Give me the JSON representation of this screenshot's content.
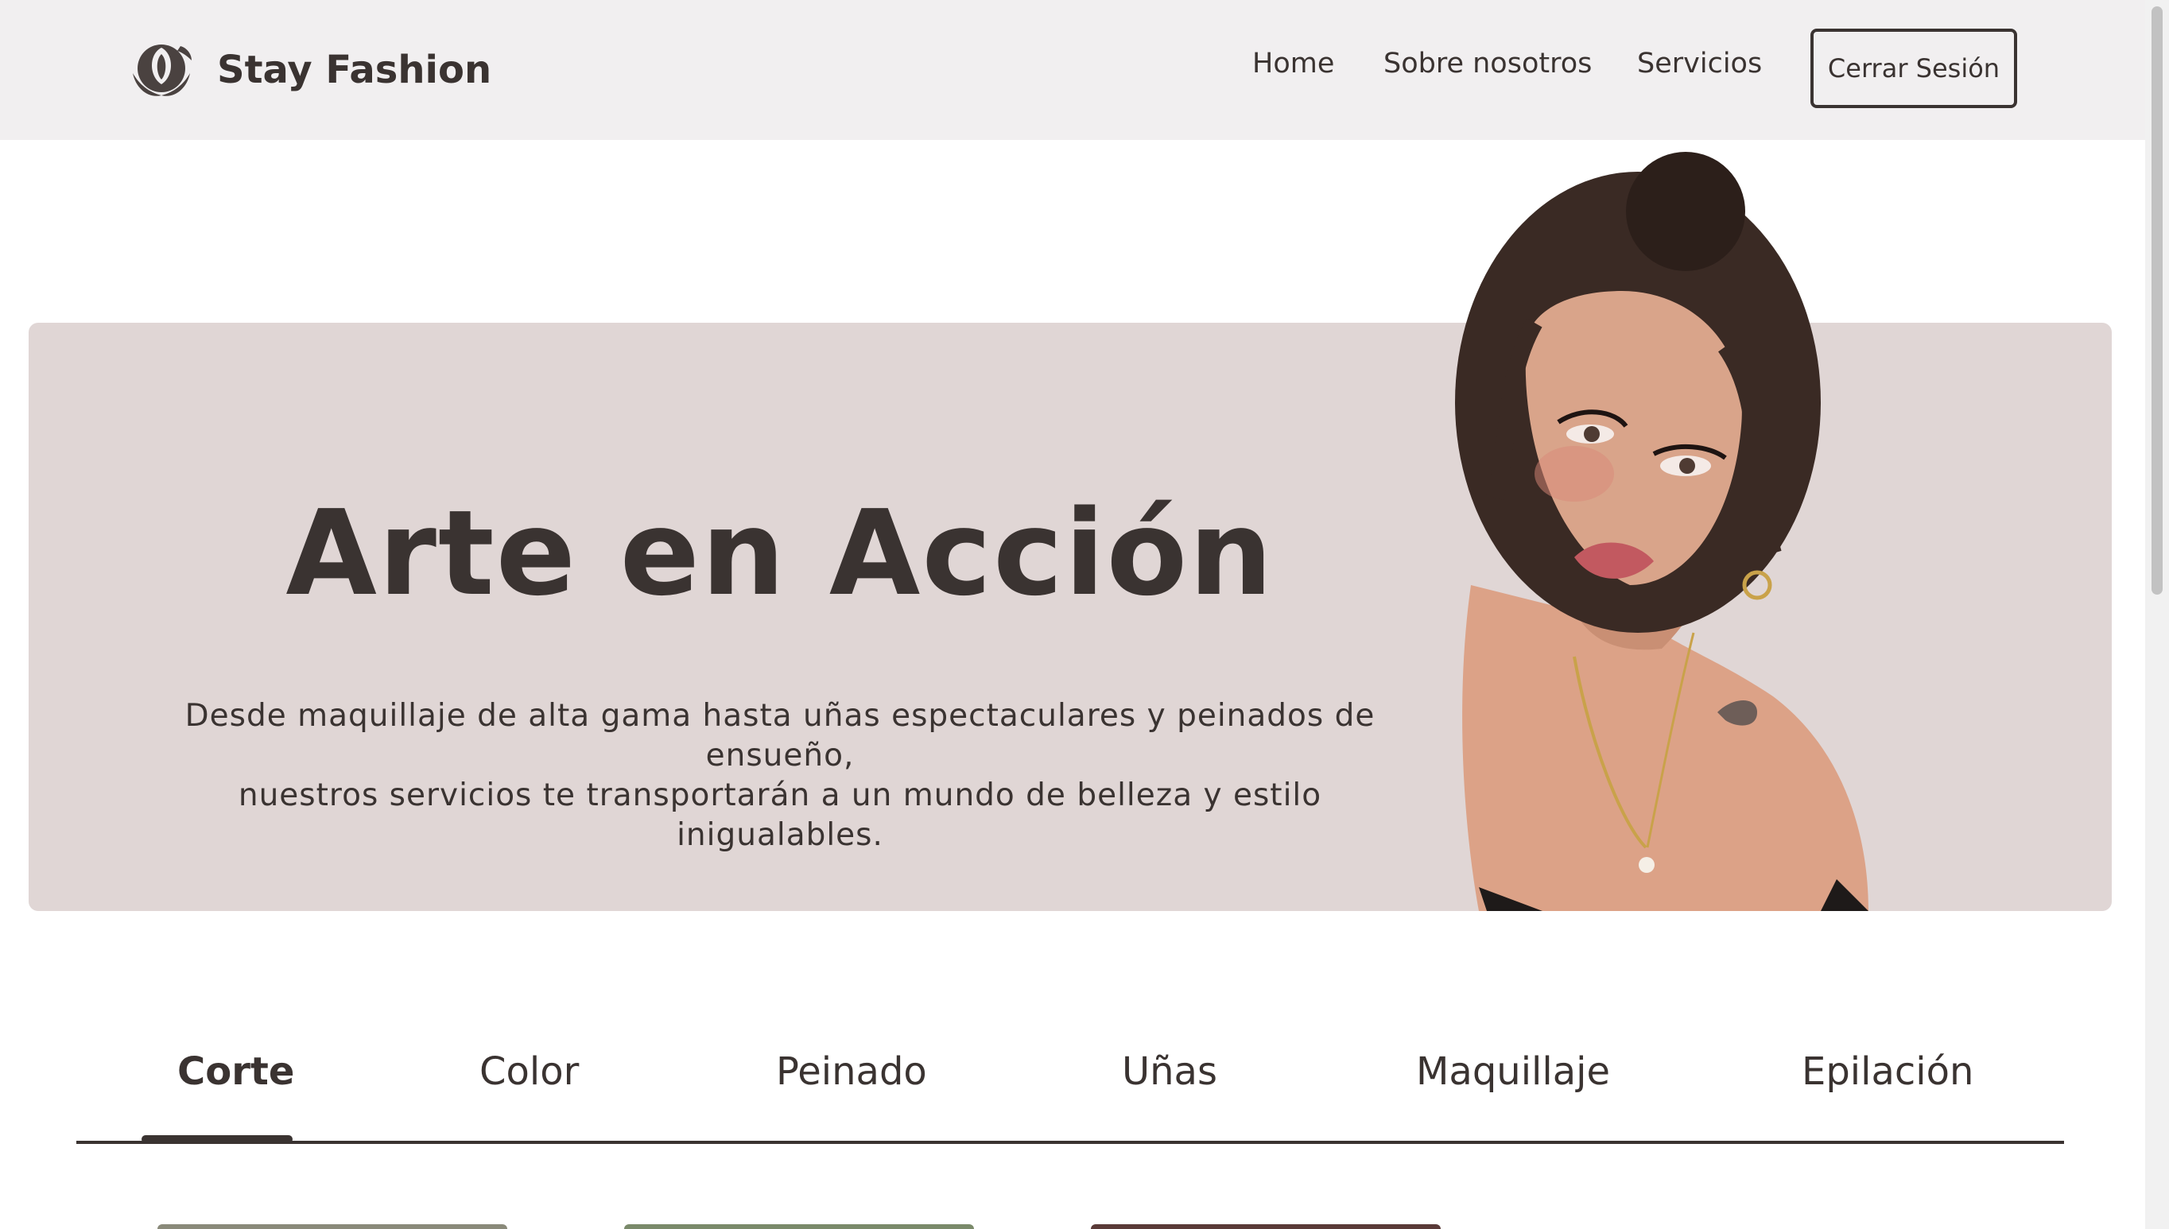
{
  "navbar": {
    "brand_name": "Stay Fashion",
    "logo_icon": "rose-logo-icon",
    "links": [
      "Home",
      "Sobre nosotros",
      "Servicios"
    ],
    "logout_label": "Cerrar Sesión"
  },
  "hero": {
    "title": "Arte en Acción",
    "text_line1": "Desde maquillaje de alta gama hasta uñas espectaculares y peinados de ensueño,",
    "text_line2": "nuestros servicios te transportarán a un mundo de belleza y estilo inigualables."
  },
  "tabs": {
    "items": [
      "Corte",
      "Color",
      "Peinado",
      "Uñas",
      "Maquillaje",
      "Epilación"
    ],
    "active": "Corte"
  },
  "colors": {
    "text": "#3a3331",
    "navbar_bg": "#f1eff0",
    "hero_bg": "#e0d6d5"
  }
}
